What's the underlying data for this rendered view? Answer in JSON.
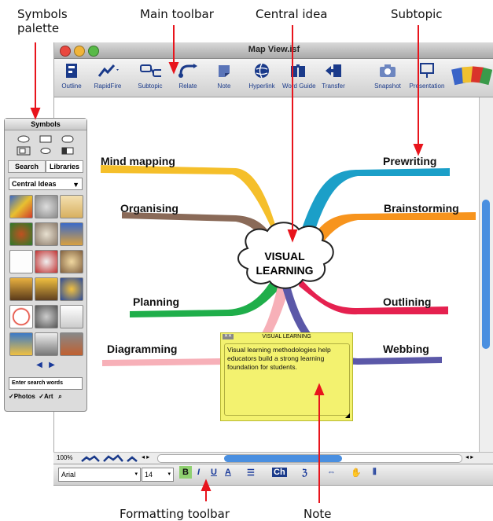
{
  "callouts": {
    "symbols": "Symbols\npalette",
    "symbols_line1": "Symbols",
    "symbols_line2": "palette",
    "main_toolbar": "Main toolbar",
    "central_idea": "Central idea",
    "subtopic": "Subtopic",
    "formatting_toolbar": "Formatting toolbar",
    "note": "Note"
  },
  "window": {
    "title": "Map View.isf",
    "toolbar": [
      "Outline",
      "RapidFire",
      "Subtopic",
      "Relate",
      "Note",
      "Hyperlink",
      "Word Guide",
      "Transfer",
      "Snapshot",
      "Presentation"
    ]
  },
  "palette": {
    "title": "Symbols",
    "tabs": [
      "Search",
      "Libraries"
    ],
    "dropdown": "Central Ideas",
    "search_placeholder": "Enter search words",
    "check_photos": "Photos",
    "check_art": "Art"
  },
  "map": {
    "central": [
      "VISUAL",
      "LEARNING"
    ],
    "left_branches": [
      "Mind mapping",
      "Organising",
      "Planning",
      "Diagramming"
    ],
    "right_branches": [
      "Prewriting",
      "Brainstorming",
      "Outlining",
      "Webbing"
    ],
    "colors": {
      "mind_mapping": "#f5bf2a",
      "organising": "#8a6a58",
      "planning": "#1fae4a",
      "diagramming": "#f7b0b8",
      "prewriting": "#1b9fc8",
      "brainstorming": "#f7941d",
      "outlining": "#e5214f",
      "webbing": "#5b58a8"
    }
  },
  "note": {
    "header": "VISUAL LEARNING",
    "body": "Visual learning methodologies help educators build a strong learning foundation for students."
  },
  "statusbar": {
    "zoom": "100%"
  },
  "format": {
    "font": "Arial",
    "size": "14"
  }
}
